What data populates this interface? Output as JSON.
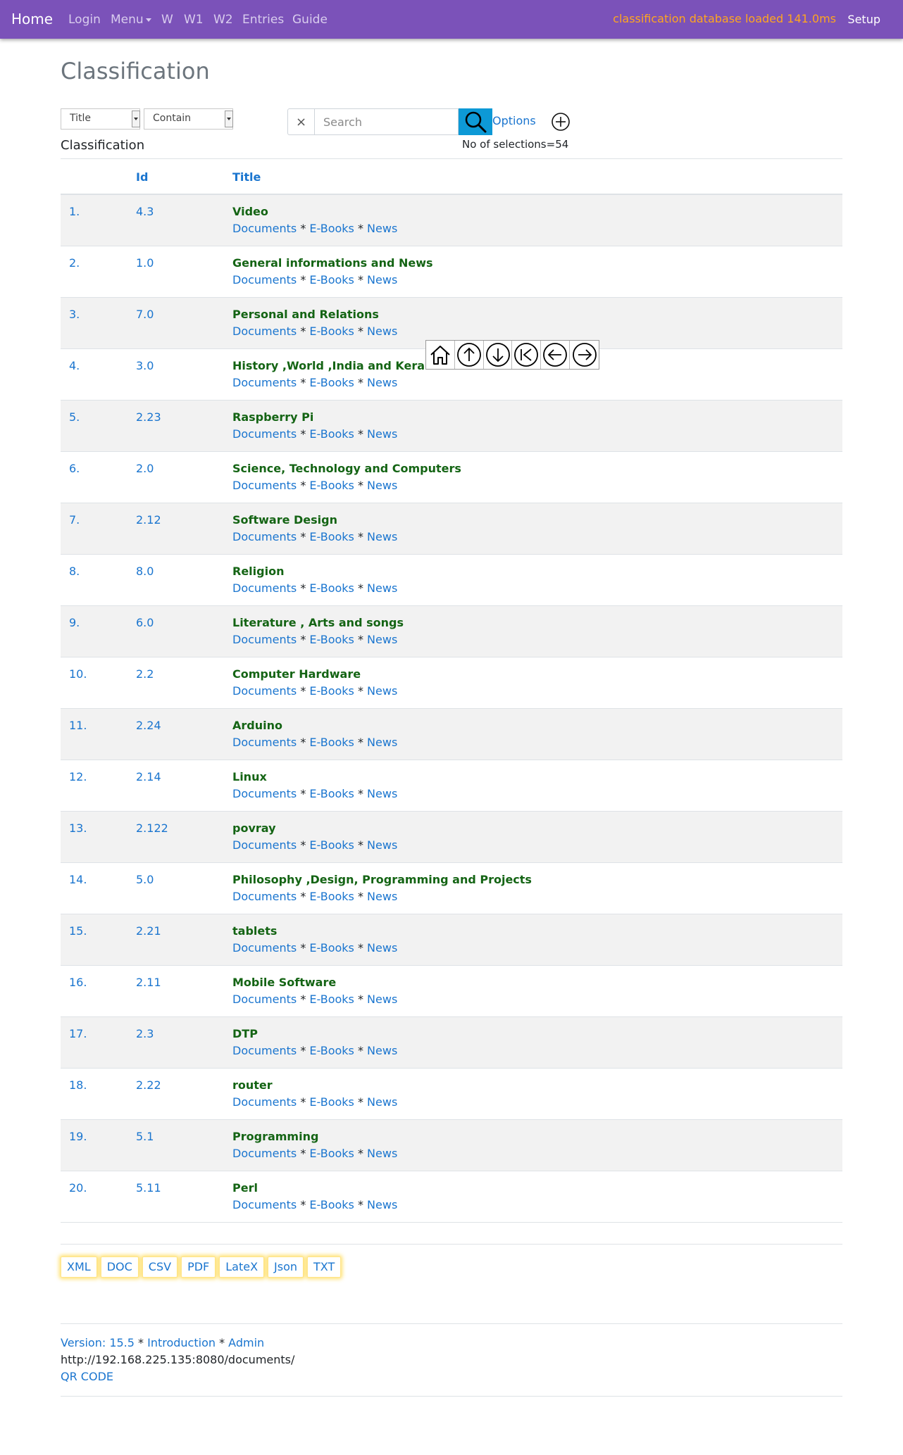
{
  "navbar": {
    "brand": "Home",
    "items": [
      "Login",
      "Menu",
      "W",
      "W1",
      "W2",
      "Entries",
      "Guide"
    ],
    "status": "classification database loaded 141.0ms",
    "setup": "Setup",
    "colors": {
      "background": "#7b52b9",
      "status": "#ffa51f"
    }
  },
  "page": {
    "title": "Classification",
    "section_label": "Classification",
    "selection_count": "No of selections=54"
  },
  "controls": {
    "field_select": "Title",
    "match_select": "Contain",
    "clear_symbol": "×",
    "search_placeholder": "Search",
    "options_label": "Options"
  },
  "table": {
    "headers": {
      "num": "",
      "id": "Id",
      "title": "Title"
    },
    "link_labels": {
      "documents": "Documents",
      "ebooks": "E-Books",
      "news": "News",
      "separator": " * "
    },
    "rows": [
      {
        "num": "1.",
        "id": "4.3",
        "title": "Video"
      },
      {
        "num": "2.",
        "id": "1.0",
        "title": "General informations and News"
      },
      {
        "num": "3.",
        "id": "7.0",
        "title": "Personal and Relations"
      },
      {
        "num": "4.",
        "id": "3.0",
        "title": "History ,World ,India and Kerala"
      },
      {
        "num": "5.",
        "id": "2.23",
        "title": "Raspberry Pi"
      },
      {
        "num": "6.",
        "id": "2.0",
        "title": "Science, Technology and Computers"
      },
      {
        "num": "7.",
        "id": "2.12",
        "title": "Software Design"
      },
      {
        "num": "8.",
        "id": "8.0",
        "title": "Religion"
      },
      {
        "num": "9.",
        "id": "6.0",
        "title": "Literature , Arts and songs"
      },
      {
        "num": "10.",
        "id": "2.2",
        "title": "Computer Hardware"
      },
      {
        "num": "11.",
        "id": "2.24",
        "title": "Arduino"
      },
      {
        "num": "12.",
        "id": "2.14",
        "title": "Linux"
      },
      {
        "num": "13.",
        "id": "2.122",
        "title": "povray"
      },
      {
        "num": "14.",
        "id": "5.0",
        "title": "Philosophy ,Design, Programming and Projects"
      },
      {
        "num": "15.",
        "id": "2.21",
        "title": "tablets"
      },
      {
        "num": "16.",
        "id": "2.11",
        "title": "Mobile Software"
      },
      {
        "num": "17.",
        "id": "2.3",
        "title": "DTP"
      },
      {
        "num": "18.",
        "id": "2.22",
        "title": "router"
      },
      {
        "num": "19.",
        "id": "5.1",
        "title": "Programming"
      },
      {
        "num": "20.",
        "id": "5.11",
        "title": "Perl"
      }
    ]
  },
  "float_nav": {
    "icons": [
      "home-icon",
      "arrow-up-icon",
      "arrow-down-icon",
      "skip-first-icon",
      "arrow-left-icon",
      "arrow-right-icon"
    ]
  },
  "exports": [
    "XML",
    "DOC",
    "CSV",
    "PDF",
    "LateX",
    "Json",
    "TXT"
  ],
  "footer": {
    "version": "Version: 15.5",
    "introduction": "Introduction",
    "admin": "Admin",
    "separator": " * ",
    "url": "http://192.168.225.135:8080/documents/",
    "qr_code": "QR CODE"
  }
}
